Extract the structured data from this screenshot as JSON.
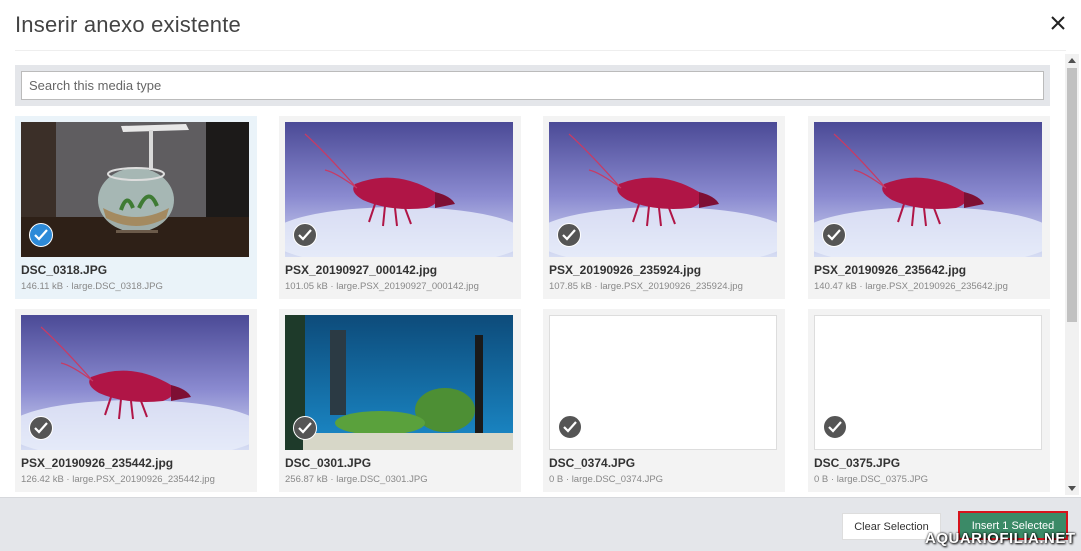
{
  "dialog": {
    "title": "Inserir anexo existente"
  },
  "search": {
    "placeholder": "Search this media type",
    "value": ""
  },
  "media": [
    {
      "name": "DSC_0318.JPG",
      "meta": "146.11 kB · large.DSC_0318.JPG",
      "selected": true,
      "image": "fishbowl"
    },
    {
      "name": "PSX_20190927_000142.jpg",
      "meta": "101.05 kB · large.PSX_20190927_000142.jpg",
      "selected": false,
      "image": "shrimp"
    },
    {
      "name": "PSX_20190926_235924.jpg",
      "meta": "107.85 kB · large.PSX_20190926_235924.jpg",
      "selected": false,
      "image": "shrimp"
    },
    {
      "name": "PSX_20190926_235642.jpg",
      "meta": "140.47 kB · large.PSX_20190926_235642.jpg",
      "selected": false,
      "image": "shrimp"
    },
    {
      "name": "PSX_20190926_235442.jpg",
      "meta": "126.42 kB · large.PSX_20190926_235442.jpg",
      "selected": false,
      "image": "shrimp"
    },
    {
      "name": "DSC_0301.JPG",
      "meta": "256.87 kB · large.DSC_0301.JPG",
      "selected": false,
      "image": "aquarium"
    },
    {
      "name": "DSC_0374.JPG",
      "meta": "0 B · large.DSC_0374.JPG",
      "selected": false,
      "image": "blank"
    },
    {
      "name": "DSC_0375.JPG",
      "meta": "0 B · large.DSC_0375.JPG",
      "selected": false,
      "image": "blank"
    }
  ],
  "footer": {
    "clear_label": "Clear Selection",
    "insert_label": "Insert 1 Selected"
  },
  "watermark": "AQUARIOFILIA.NET",
  "colors": {
    "selected_check": "#2d8ad8",
    "insert_button": "#3b8a67",
    "footer_bg": "#e4e6ea"
  }
}
